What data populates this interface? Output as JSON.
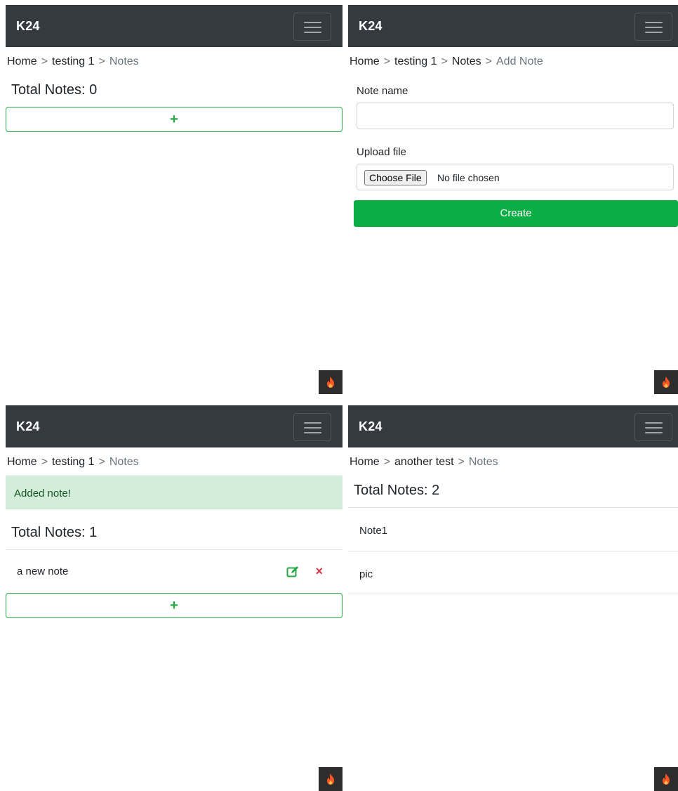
{
  "brand": "K24",
  "colors": {
    "navbar": "#343a40",
    "success": "#28a745",
    "danger": "#dc3545",
    "create_button": "#0bad45",
    "alert_bg": "#d4edda"
  },
  "panels": {
    "top_left": {
      "breadcrumb": {
        "home": "Home",
        "sep": ">",
        "project": "testing 1",
        "current": "Notes"
      },
      "total_label": "Total Notes: 0",
      "add_button": "+"
    },
    "top_right": {
      "breadcrumb": {
        "home": "Home",
        "sep": ">",
        "project": "testing 1",
        "notes": "Notes",
        "current": "Add Note"
      },
      "note_name_label": "Note name",
      "note_name_value": "",
      "upload_label": "Upload file",
      "choose_file_button": "Choose File",
      "file_status": "No file chosen",
      "create_button": "Create"
    },
    "bottom_left": {
      "breadcrumb": {
        "home": "Home",
        "sep": ">",
        "project": "testing 1",
        "current": "Notes"
      },
      "alert": "Added note!",
      "total_label": "Total Notes: 1",
      "notes": [
        {
          "name": "a new note",
          "edit_icon": "edit-icon",
          "delete_icon": "×"
        }
      ],
      "add_button": "+"
    },
    "bottom_right": {
      "breadcrumb": {
        "home": "Home",
        "sep": ">",
        "project": "another test",
        "current": "Notes"
      },
      "total_label": "Total Notes: 2",
      "notes": [
        {
          "name": "Note1"
        },
        {
          "name": "pic"
        }
      ]
    }
  },
  "icons": {
    "menu": "hamburger-menu-icon",
    "badge": "flame-icon"
  }
}
